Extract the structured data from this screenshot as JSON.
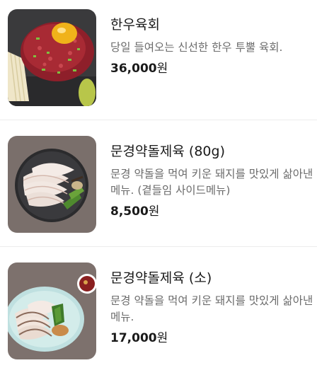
{
  "menu": {
    "items": [
      {
        "name": "한우육회",
        "description": "당일 들여오는 신선한 한우 투뿔 육회.",
        "price": "36,000",
        "currency": "원",
        "image_icon": "yukhoe-photo"
      },
      {
        "name": "문경약돌제육 (80g)",
        "description": "문경 약돌을 먹여 키운 돼지를 맛있게 삶아낸 메뉴. (곁들임 사이드메뉴)",
        "price": "8,500",
        "currency": "원",
        "image_icon": "boiled-pork-photo"
      },
      {
        "name": "문경약돌제육 (소)",
        "description": "문경 약돌을 먹여 키운 돼지를 맛있게 삶아낸 메뉴.",
        "price": "17,000",
        "currency": "원",
        "image_icon": "boiled-pork-platter-photo"
      }
    ]
  }
}
